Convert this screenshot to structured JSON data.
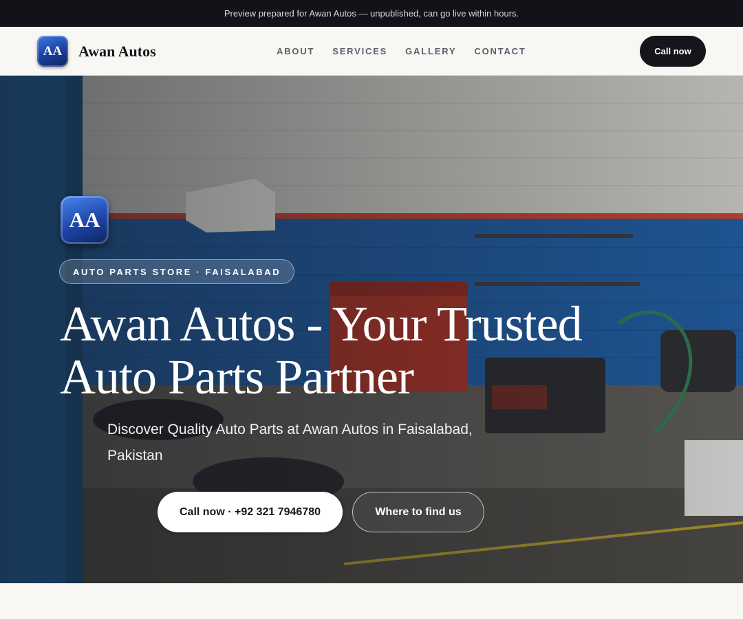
{
  "banner": {
    "text": "Preview prepared for Awan Autos — unpublished, can go live within hours."
  },
  "header": {
    "logo_initials": "AA",
    "brand_name": "Awan Autos",
    "nav": [
      {
        "label": "ABOUT"
      },
      {
        "label": "SERVICES"
      },
      {
        "label": "GALLERY"
      },
      {
        "label": "CONTACT"
      }
    ],
    "cta_label": "Call now"
  },
  "hero": {
    "logo_initials": "AA",
    "tag": "AUTO PARTS STORE · FAISALABAD",
    "title": "Awan Autos - Your Trusted Auto Parts Partner",
    "subtitle": "Discover Quality Auto Parts at Awan Autos in Faisalabad, Pakistan",
    "primary_button": "Call now · +92 321 7946780",
    "secondary_button": "Where to find us",
    "background_image": "auto-parts-workshop-photo"
  },
  "colors": {
    "banner_bg": "#111318",
    "header_bg": "#f8f7f3",
    "dark_button": "#14161b",
    "logo_blue": "#1d45a6",
    "wall_blue": "#1f5a9e"
  }
}
